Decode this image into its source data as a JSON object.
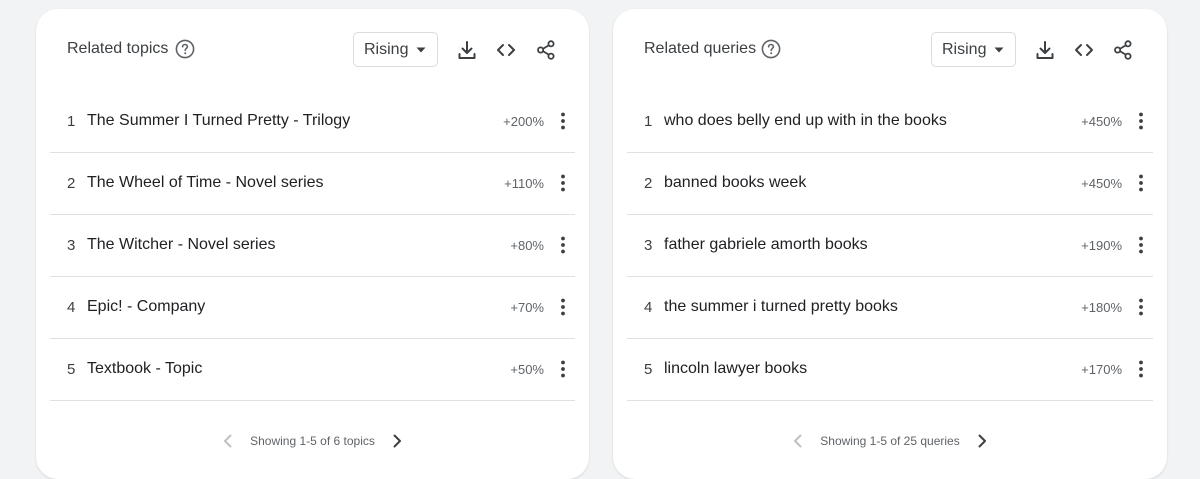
{
  "topics": {
    "title": "Related topics",
    "help_icon": "help-circle-icon",
    "filter_selected": "Rising",
    "tools": [
      "download-icon",
      "embed-code-icon",
      "share-icon"
    ],
    "rows": [
      {
        "rank": "1",
        "label": "The Summer I Turned Pretty - Trilogy",
        "value": "+200%"
      },
      {
        "rank": "2",
        "label": "The Wheel of Time - Novel series",
        "value": "+110%"
      },
      {
        "rank": "3",
        "label": "The Witcher - Novel series",
        "value": "+80%"
      },
      {
        "rank": "4",
        "label": "Epic! - Company",
        "value": "+70%"
      },
      {
        "rank": "5",
        "label": "Textbook - Topic",
        "value": "+50%"
      }
    ],
    "pagination": "Showing 1-5 of 6 topics"
  },
  "queries": {
    "title": "Related queries",
    "help_icon": "help-circle-icon",
    "filter_selected": "Rising",
    "tools": [
      "download-icon",
      "embed-code-icon",
      "share-icon"
    ],
    "rows": [
      {
        "rank": "1",
        "label": "who does belly end up with in the books",
        "value": "+450%"
      },
      {
        "rank": "2",
        "label": "banned books week",
        "value": "+450%"
      },
      {
        "rank": "3",
        "label": "father gabriele amorth books",
        "value": "+190%"
      },
      {
        "rank": "4",
        "label": "the summer i turned pretty books",
        "value": "+180%"
      },
      {
        "rank": "5",
        "label": "lincoln lawyer books",
        "value": "+170%"
      }
    ],
    "pagination": "Showing 1-5 of 25 queries"
  },
  "colors": {
    "background": "#f1f3f4",
    "card": "#ffffff",
    "divider": "#e0e0e0",
    "text_primary": "#202124",
    "text_secondary": "#5f6368",
    "arrow_disabled": "#bdc1c6"
  }
}
